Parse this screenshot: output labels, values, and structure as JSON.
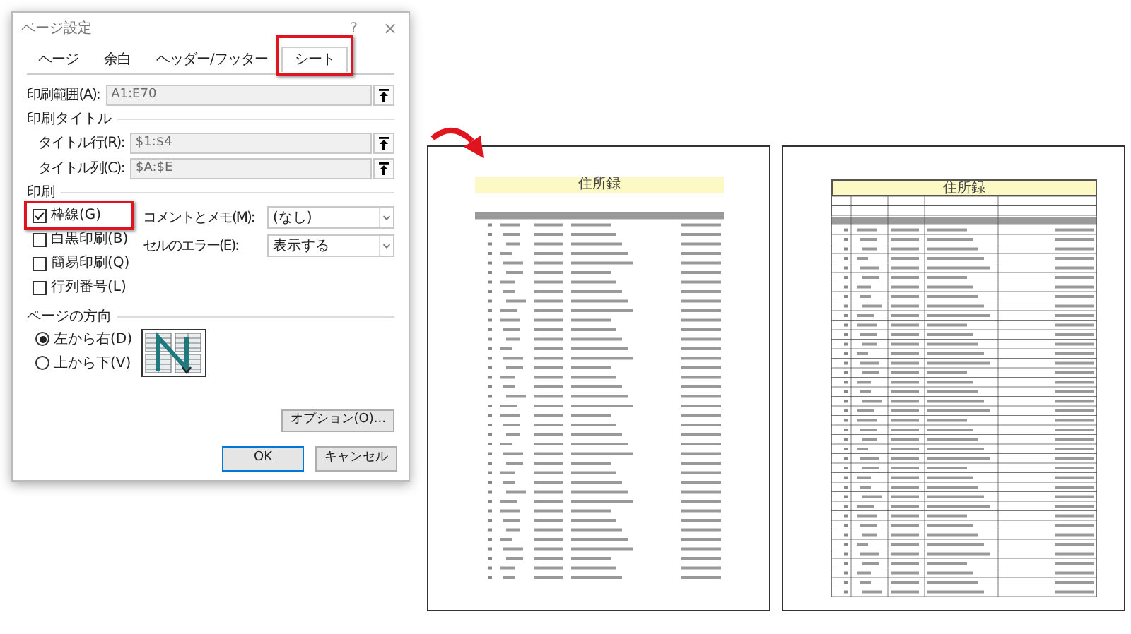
{
  "dialog": {
    "title": "ページ設定",
    "help": "?",
    "close": "×",
    "tabs": [
      {
        "label": "ページ",
        "selected": false,
        "highlighted": false
      },
      {
        "label": "余白",
        "selected": false,
        "highlighted": false
      },
      {
        "label": "ヘッダー/フッター",
        "selected": false,
        "highlighted": false
      },
      {
        "label": "シート",
        "selected": true,
        "highlighted": true
      }
    ],
    "print_area": {
      "label": "印刷範囲(A):",
      "value": "A1:E70"
    },
    "print_titles": {
      "heading": "印刷タイトル",
      "fields": [
        {
          "label": "タイトル行(R):",
          "value": "$1:$4"
        },
        {
          "label": "タイトル列(C):",
          "value": "$A:$E"
        }
      ]
    },
    "print": {
      "heading": "印刷",
      "checkboxes": [
        {
          "label": "枠線(G)",
          "checked": true,
          "highlighted": true
        },
        {
          "label": "白黒印刷(B)",
          "checked": false,
          "highlighted": false
        },
        {
          "label": "簡易印刷(Q)",
          "checked": false,
          "highlighted": false
        },
        {
          "label": "行列番号(L)",
          "checked": false,
          "highlighted": false
        }
      ],
      "selects": [
        {
          "label": "コメントとメモ(M):",
          "value": "(なし)"
        },
        {
          "label": "セルのエラー(E):",
          "value": "表示する"
        }
      ]
    },
    "page_order": {
      "heading": "ページの方向",
      "options": [
        {
          "label": "左から右(D)",
          "selected": true
        },
        {
          "label": "上から下(V)",
          "selected": false
        }
      ]
    },
    "options_button": "オプション(O)...",
    "buttons": [
      {
        "label": "OK",
        "default": true
      },
      {
        "label": "キャンセル",
        "default": false
      }
    ]
  },
  "previews": [
    {
      "title": "住所録",
      "gridlines": false
    },
    {
      "title": "住所録",
      "gridlines": true
    }
  ]
}
